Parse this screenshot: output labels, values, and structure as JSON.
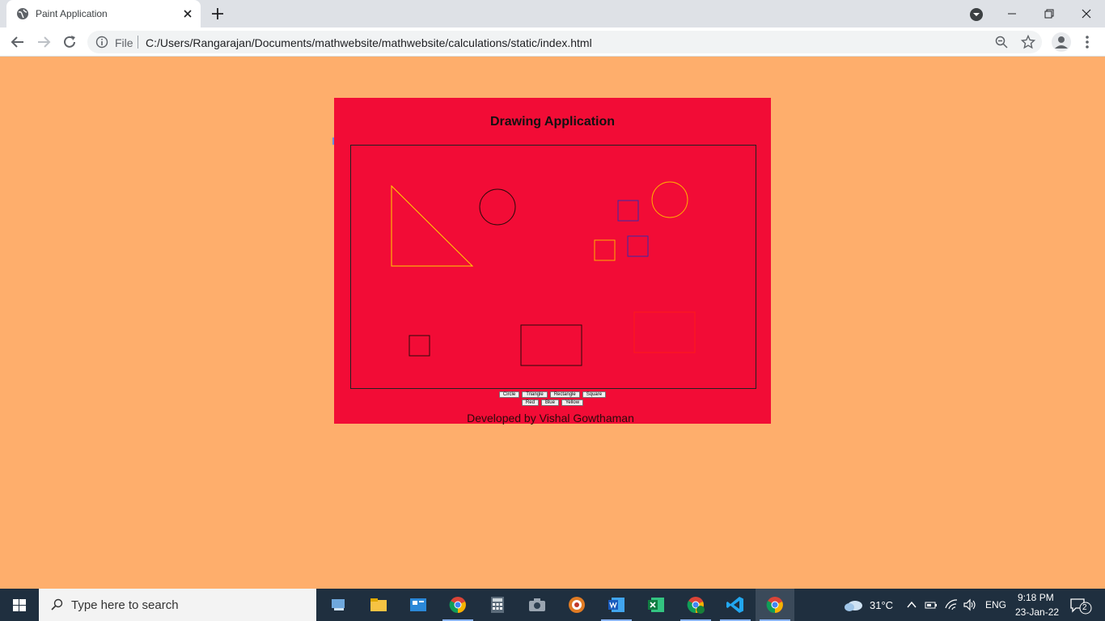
{
  "browser": {
    "tab_title": "Paint Application",
    "address": {
      "scheme_label": "File",
      "url": "C:/Users/Rangarajan/Documents/mathwebsite/mathwebsite/calculations/static/index.html"
    }
  },
  "page": {
    "title": "Drawing Application",
    "shape_buttons": [
      "Circle",
      "Triangle",
      "Rectangle",
      "Square"
    ],
    "color_buttons": [
      "Red",
      "Blue",
      "Yellow"
    ],
    "footer": "Developed by Vishal Gowthaman",
    "colors": {
      "background": "#feae6c",
      "panel": "#f20c36"
    }
  },
  "taskbar": {
    "search_placeholder": "Type here to search",
    "weather": "31°C",
    "language": "ENG",
    "time": "9:18 PM",
    "date": "23-Jan-22",
    "notification_count": "2"
  }
}
